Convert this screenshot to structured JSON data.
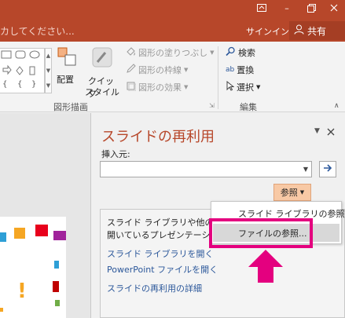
{
  "titlebar": {
    "tell_me_text": "カしてください...",
    "signin_label": "サインイン",
    "share_label": "共有",
    "restore_icon": "ribbon-display-icon",
    "minimize_label": "–",
    "maximize_label": "□"
  },
  "ribbon": {
    "arrange_label": "配置",
    "quick_styles_line1": "クイック",
    "quick_styles_line2": "スタイル",
    "shape_fill_label": "図形の塗りつぶし",
    "shape_outline_label": "図形の枠線",
    "shape_effects_label": "図形の効果",
    "drawing_group_label": "図形描画",
    "find_label": "検索",
    "replace_label": "置換",
    "select_label": "選択",
    "editing_group_label": "編集"
  },
  "pane": {
    "title": "スライドの再利用",
    "insert_from_label": "挿入元:",
    "combo_value": "",
    "browse_label": "参照",
    "info_line1": "スライド ライブラリや他の  Pov",
    "info_line2": "開いているプレゼンテーション",
    "link_open_library": "スライド ライブラリを開く",
    "link_open_file": "PowerPoint ファイルを開く",
    "link_details": "スライドの再利用の詳細"
  },
  "menu": {
    "items": [
      {
        "label": "スライド ライブラリの参照..."
      },
      {
        "label": "ファイルの参照..."
      }
    ]
  },
  "colors": {
    "accent": "#b7472a",
    "highlight": "#e4007f",
    "browse_button": "#f8c9a5",
    "link": "#2b579a"
  }
}
